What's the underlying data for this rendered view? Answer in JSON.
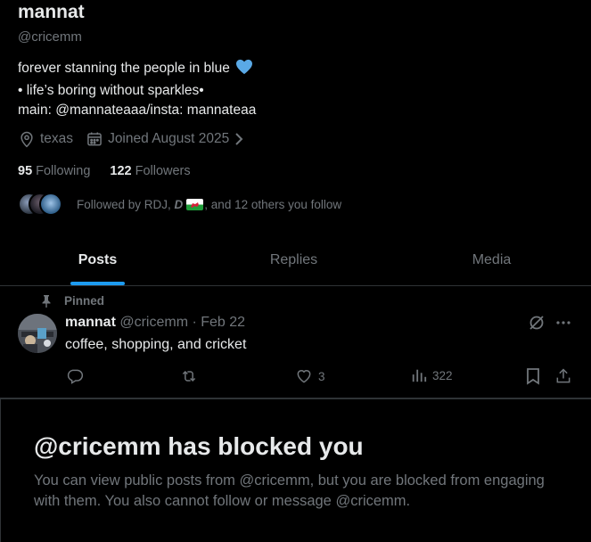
{
  "profile": {
    "name": "mannat",
    "handle": "@cricemm",
    "bio": [
      "forever stanning the people in blue",
      "• life’s boring without sparkles•",
      "main: @mannateaaa/insta: mannateaa"
    ],
    "location": "texas",
    "joined": "Joined August 2025",
    "following_count": "95",
    "following_label": "Following",
    "followers_count": "122",
    "followers_label": "Followers",
    "followed_by_prefix": "Followed by RDJ, ",
    "followed_by_bold": "D",
    "followed_by_suffix": ", and 12 others you follow"
  },
  "tabs": [
    {
      "label": "Posts",
      "active": true
    },
    {
      "label": "Replies",
      "active": false
    },
    {
      "label": "Media",
      "active": false
    }
  ],
  "pinned_post": {
    "pinned_label": "Pinned",
    "author_name": "mannat",
    "author_handle_date": "@cricemm · Feb 22",
    "text": "coffee, shopping, and cricket",
    "likes": "3",
    "views": "322"
  },
  "blocked_notice": {
    "title": "@cricemm has blocked you",
    "description": "You can view public posts from @cricemm, but you are blocked from engaging with them. You also cannot follow or message @cricemm."
  },
  "colors": {
    "background": "#000000",
    "text_primary": "#e7e9ea",
    "text_secondary": "#71767b",
    "accent": "#1d9bf0",
    "divider": "#2f3336",
    "heart": "#5aa9e6"
  },
  "icons": [
    "location-icon",
    "calendar-icon",
    "chevron-right-icon",
    "pin-icon",
    "grok-icon",
    "more-icon",
    "reply-icon",
    "repost-icon",
    "like-icon",
    "views-icon",
    "bookmark-icon",
    "share-icon"
  ]
}
